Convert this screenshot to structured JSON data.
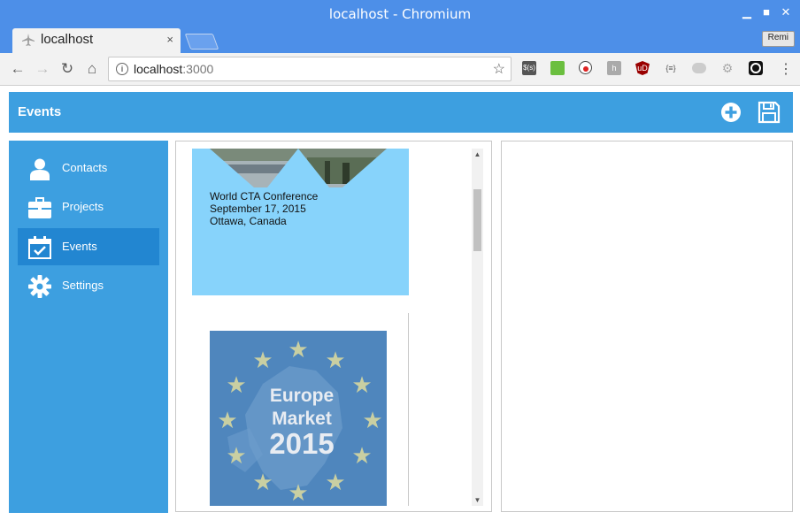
{
  "window": {
    "title": "localhost - Chromium"
  },
  "tab": {
    "label": "localhost",
    "close": "×",
    "favicon": "airplane-icon"
  },
  "profile": {
    "name": "Remi"
  },
  "omnibox": {
    "host": "localhost",
    "port": ":3000"
  },
  "extensions": [
    "dollar-s-icon",
    "green-square-icon",
    "record-icon",
    "h-icon",
    "ublock-icon",
    "brackets-icon",
    "gray-pill-icon",
    "gear-icon",
    "eye-icon"
  ],
  "app": {
    "header_title": "Events",
    "accent": "#3d9fe0",
    "active_color": "#2286d1"
  },
  "sidebar": {
    "items": [
      {
        "label": "Contacts",
        "icon": "person-icon"
      },
      {
        "label": "Projects",
        "icon": "briefcase-icon"
      },
      {
        "label": "Events",
        "icon": "calendar-check-icon",
        "active": true
      },
      {
        "label": "Settings",
        "icon": "gear-icon"
      }
    ]
  },
  "events": [
    {
      "title": "World CTA Conference",
      "date": "September 17, 2015",
      "location": "Ottawa, Canada",
      "card_color": "#87d3fb"
    },
    {
      "image_text": [
        "Europe",
        "Market",
        "2015"
      ]
    }
  ]
}
